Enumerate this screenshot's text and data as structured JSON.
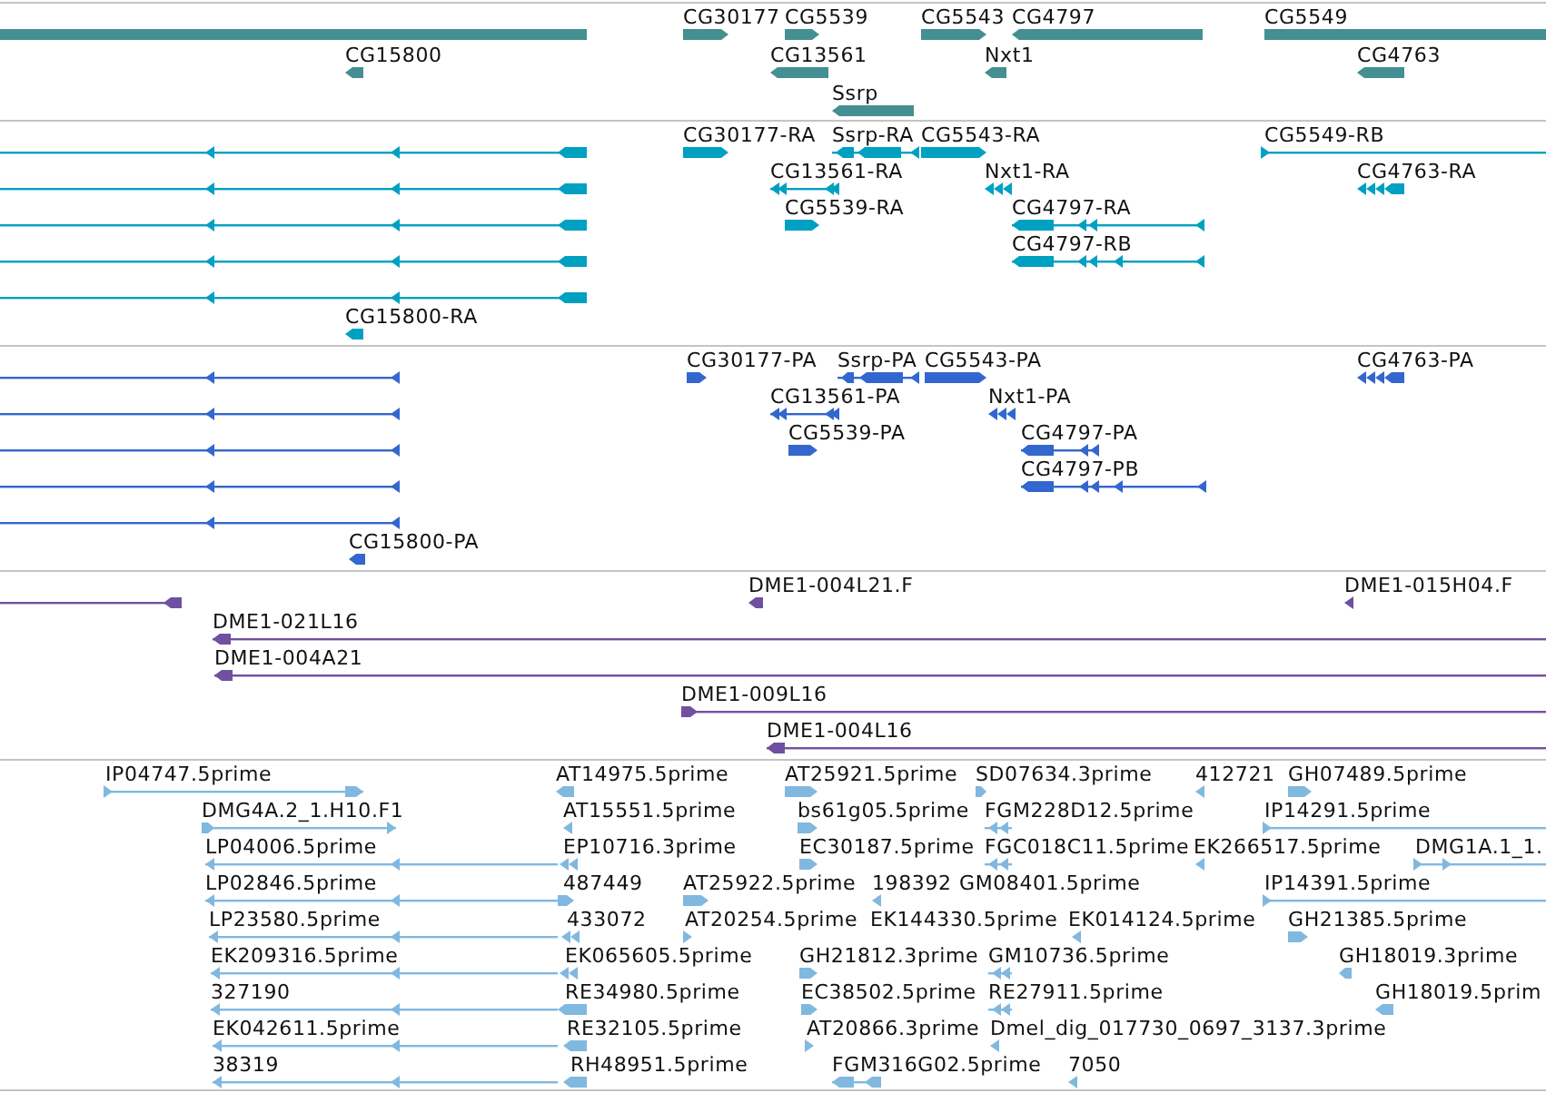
{
  "tracks": [
    {
      "kind": "gene",
      "features": [
        {
          "reverse": true
        },
        {
          "label": "CG30177",
          "reverse": false
        },
        {
          "label": "CG5539",
          "reverse": false
        },
        {
          "label": "CG5543",
          "reverse": false
        },
        {
          "label": "CG4797",
          "reverse": true
        },
        {
          "label": "CG5549",
          "reverse": false
        },
        {
          "label": "CG15800",
          "reverse": true
        },
        {
          "label": "CG13561",
          "reverse": true
        },
        {
          "label": "Nxt1",
          "reverse": true
        },
        {
          "label": "CG4763",
          "reverse": true
        },
        {
          "label": "Ssrp",
          "reverse": true
        }
      ]
    },
    {
      "kind": "transcript",
      "features": [
        {
          "reverse": true
        },
        {
          "reverse": true
        },
        {
          "reverse": true
        },
        {
          "reverse": true
        },
        {
          "reverse": true
        },
        {
          "label": "CG30177-RA",
          "reverse": false
        },
        {
          "label": "Ssrp-RA",
          "reverse": true
        },
        {
          "label": "CG5543-RA",
          "reverse": false
        },
        {
          "label": "CG5549-RB",
          "reverse": false
        },
        {
          "label": "CG13561-RA",
          "reverse": true
        },
        {
          "label": "Nxt1-RA",
          "reverse": true
        },
        {
          "label": "CG4763-RA",
          "reverse": true
        },
        {
          "label": "CG5539-RA",
          "reverse": false
        },
        {
          "label": "CG4797-RA",
          "reverse": true
        },
        {
          "label": "CG4797-RB",
          "reverse": true
        },
        {
          "label": "CG15800-RA",
          "reverse": true
        }
      ]
    },
    {
      "kind": "protein",
      "features": [
        {
          "reverse": true
        },
        {
          "reverse": true
        },
        {
          "reverse": true
        },
        {
          "reverse": true
        },
        {
          "reverse": true
        },
        {
          "label": "CG30177-PA",
          "reverse": false
        },
        {
          "label": "Ssrp-PA",
          "reverse": true
        },
        {
          "label": "CG5543-PA",
          "reverse": false
        },
        {
          "label": "CG4763-PA",
          "reverse": true
        },
        {
          "label": "CG13561-PA",
          "reverse": true
        },
        {
          "label": "Nxt1-PA",
          "reverse": true
        },
        {
          "label": "CG5539-PA",
          "reverse": false
        },
        {
          "label": "CG4797-PA",
          "reverse": true
        },
        {
          "label": "CG4797-PB",
          "reverse": true
        },
        {
          "label": "CG15800-PA",
          "reverse": true
        }
      ]
    },
    {
      "kind": "clone",
      "features": [
        {
          "reverse": true
        },
        {
          "label": "DME1-004L21.F",
          "reverse": true
        },
        {
          "label": "DME1-015H04.F",
          "reverse": true
        },
        {
          "label": "DME1-021L16",
          "reverse": true
        },
        {
          "label": "DME1-004A21",
          "reverse": true
        },
        {
          "label": "DME1-009L16",
          "reverse": false
        },
        {
          "label": "DME1-004L16",
          "reverse": true
        }
      ]
    },
    {
      "kind": "est",
      "features": [
        {
          "label": "IP04747.5prime",
          "reverse": false
        },
        {
          "label": "AT14975.5prime",
          "reverse": true
        },
        {
          "label": "AT25921.5prime",
          "reverse": false
        },
        {
          "label": "SD07634.3prime",
          "reverse": false
        },
        {
          "label": "412721",
          "reverse": true
        },
        {
          "label": "GH07489.5prime",
          "reverse": false
        },
        {
          "label": "DMG4A.2_1.H10.F1",
          "reverse": false
        },
        {
          "label": "AT15551.5prime",
          "reverse": true
        },
        {
          "label": "bs61g05.5prime",
          "reverse": false
        },
        {
          "label": "FGM228D12.5prime",
          "reverse": true
        },
        {
          "label": "IP14291.5prime",
          "reverse": false
        },
        {
          "label": "LP04006.5prime",
          "reverse": true
        },
        {
          "label": "EP10716.3prime",
          "reverse": true
        },
        {
          "label": "EC30187.5prime",
          "reverse": false
        },
        {
          "label": "FGC018C11.5prime",
          "reverse": true
        },
        {
          "label": "EK266517.5prime",
          "reverse": true
        },
        {
          "label": "DMG1A.1_1.",
          "reverse": false
        },
        {
          "label": "LP02846.5prime",
          "reverse": true
        },
        {
          "label": "487449",
          "reverse": false
        },
        {
          "label": "AT25922.5prime",
          "reverse": false
        },
        {
          "label": "198392",
          "reverse": true
        },
        {
          "label": "GM08401.5prime"
        },
        {
          "label": "IP14391.5prime",
          "reverse": false
        },
        {
          "label": "LP23580.5prime",
          "reverse": true
        },
        {
          "label": "433072",
          "reverse": true
        },
        {
          "label": "AT20254.5prime",
          "reverse": false
        },
        {
          "label": "EK144330.5prime"
        },
        {
          "label": "EK014124.5prime",
          "reverse": true
        },
        {
          "label": "GH21385.5prime",
          "reverse": false
        },
        {
          "label": "EK209316.5prime",
          "reverse": true
        },
        {
          "label": "EK065605.5prime",
          "reverse": true
        },
        {
          "label": "GH21812.3prime",
          "reverse": false
        },
        {
          "label": "GM10736.5prime",
          "reverse": true
        },
        {
          "label": "GH18019.3prime",
          "reverse": true
        },
        {
          "label": "327190",
          "reverse": true
        },
        {
          "label": "RE34980.5prime",
          "reverse": true
        },
        {
          "label": "EC38502.5prime",
          "reverse": false
        },
        {
          "label": "RE27911.5prime",
          "reverse": true
        },
        {
          "label": "GH18019.5prim",
          "reverse": true
        },
        {
          "label": "EK042611.5prime",
          "reverse": true
        },
        {
          "label": "RE32105.5prime",
          "reverse": true
        },
        {
          "label": "AT20866.3prime",
          "reverse": false
        },
        {
          "label": "Dmel_dig_017730_0697_3137.3prime",
          "reverse": true
        },
        {
          "label": "38319",
          "reverse": true
        },
        {
          "label": "RH48951.5prime",
          "reverse": true
        },
        {
          "label": "FGM316G02.5prime",
          "reverse": true
        },
        {
          "label": "7050",
          "reverse": true
        }
      ]
    }
  ]
}
